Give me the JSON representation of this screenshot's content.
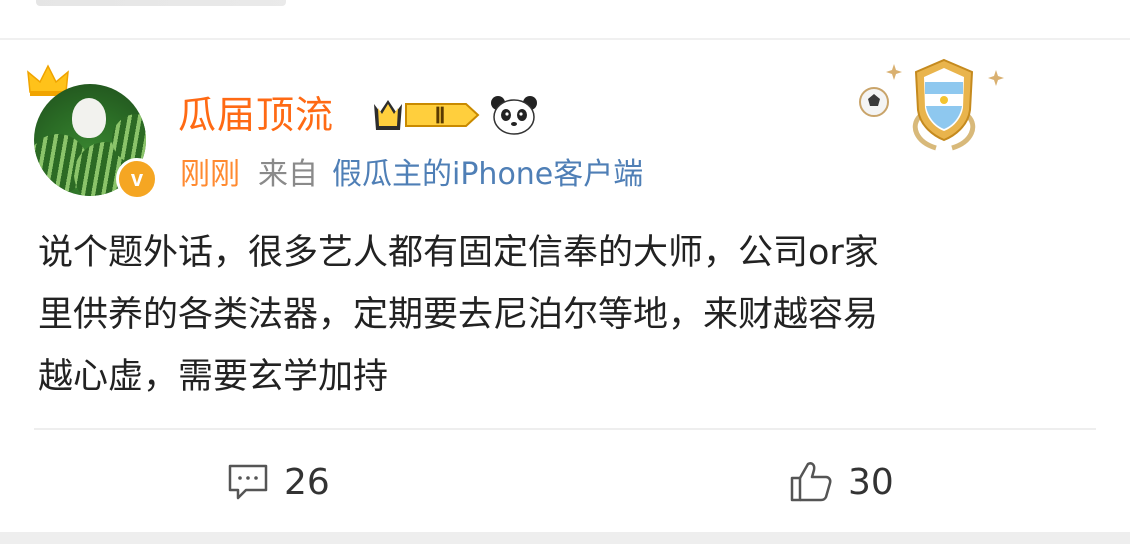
{
  "post": {
    "username": "瓜届顶流",
    "time": "刚刚",
    "from_label": "来自",
    "client": "假瓜主的iPhone客户端",
    "level_badge": "Ⅱ",
    "text_lines": [
      "说个题外话，很多艺人都有固定信奉的大师，公司or家",
      "里供养的各类法器，定期要去尼泊尔等地，来财越容易",
      "越心虚，需要玄学加持"
    ]
  },
  "actions": {
    "comment_count": "26",
    "like_count": "30"
  },
  "colors": {
    "username": "#ff6a14",
    "time": "#ff8a30",
    "client_link": "#4f7fb6",
    "text": "#222222"
  }
}
